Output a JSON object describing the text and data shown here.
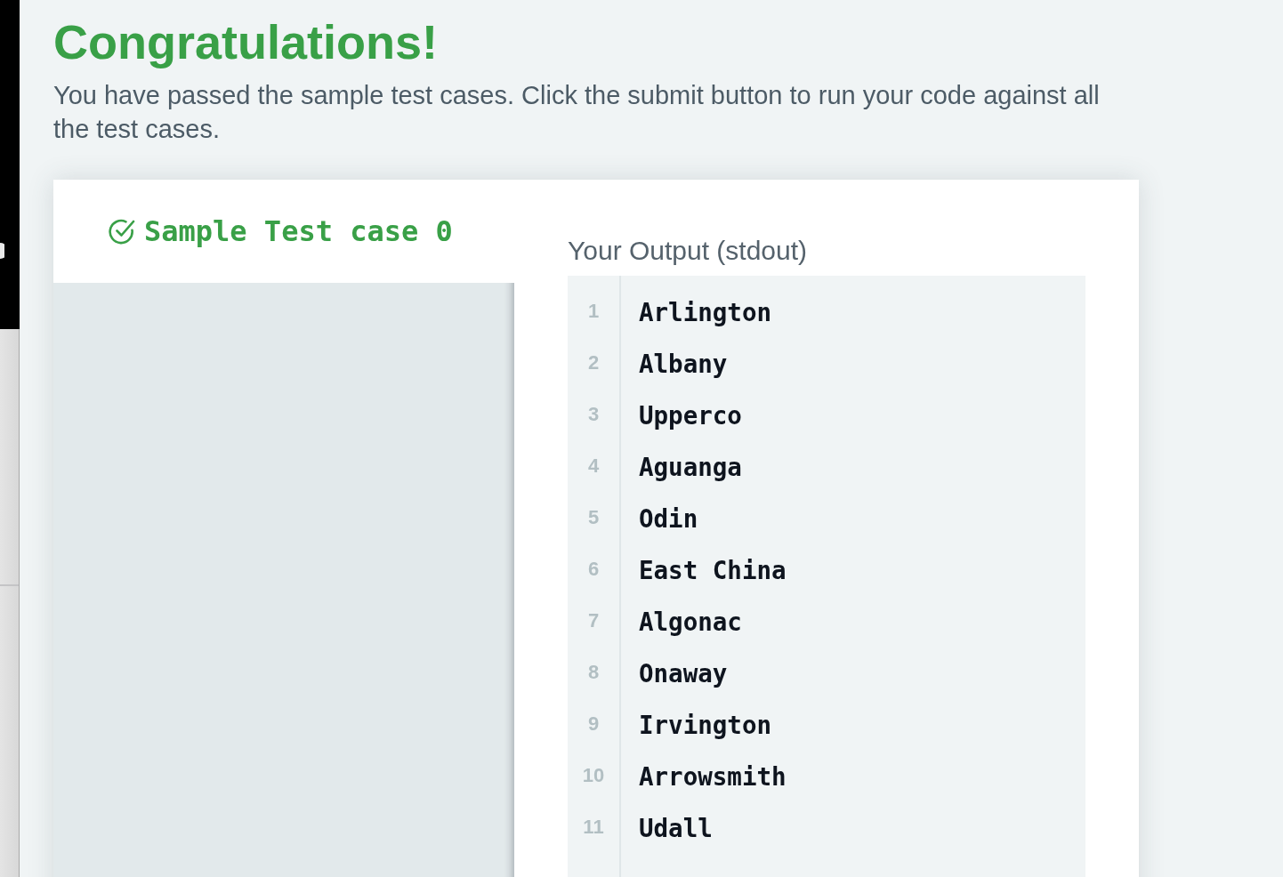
{
  "heading": "Congratulations!",
  "message": "You have passed the sample test cases. Click the submit button to run your code against all the test cases.",
  "test_cases": [
    {
      "label": "Sample Test case 0",
      "passed": true,
      "selected": true
    }
  ],
  "output": {
    "label": "Your Output (stdout)",
    "lines": [
      {
        "number": "1",
        "text": "Arlington"
      },
      {
        "number": "2",
        "text": "Albany"
      },
      {
        "number": "3",
        "text": "Upperco"
      },
      {
        "number": "4",
        "text": "Aguanga"
      },
      {
        "number": "5",
        "text": "Odin"
      },
      {
        "number": "6",
        "text": "East China"
      },
      {
        "number": "7",
        "text": "Algonac"
      },
      {
        "number": "8",
        "text": "Onaway"
      },
      {
        "number": "9",
        "text": "Irvington"
      },
      {
        "number": "10",
        "text": "Arrowsmith"
      },
      {
        "number": "11",
        "text": "Udall"
      }
    ]
  }
}
